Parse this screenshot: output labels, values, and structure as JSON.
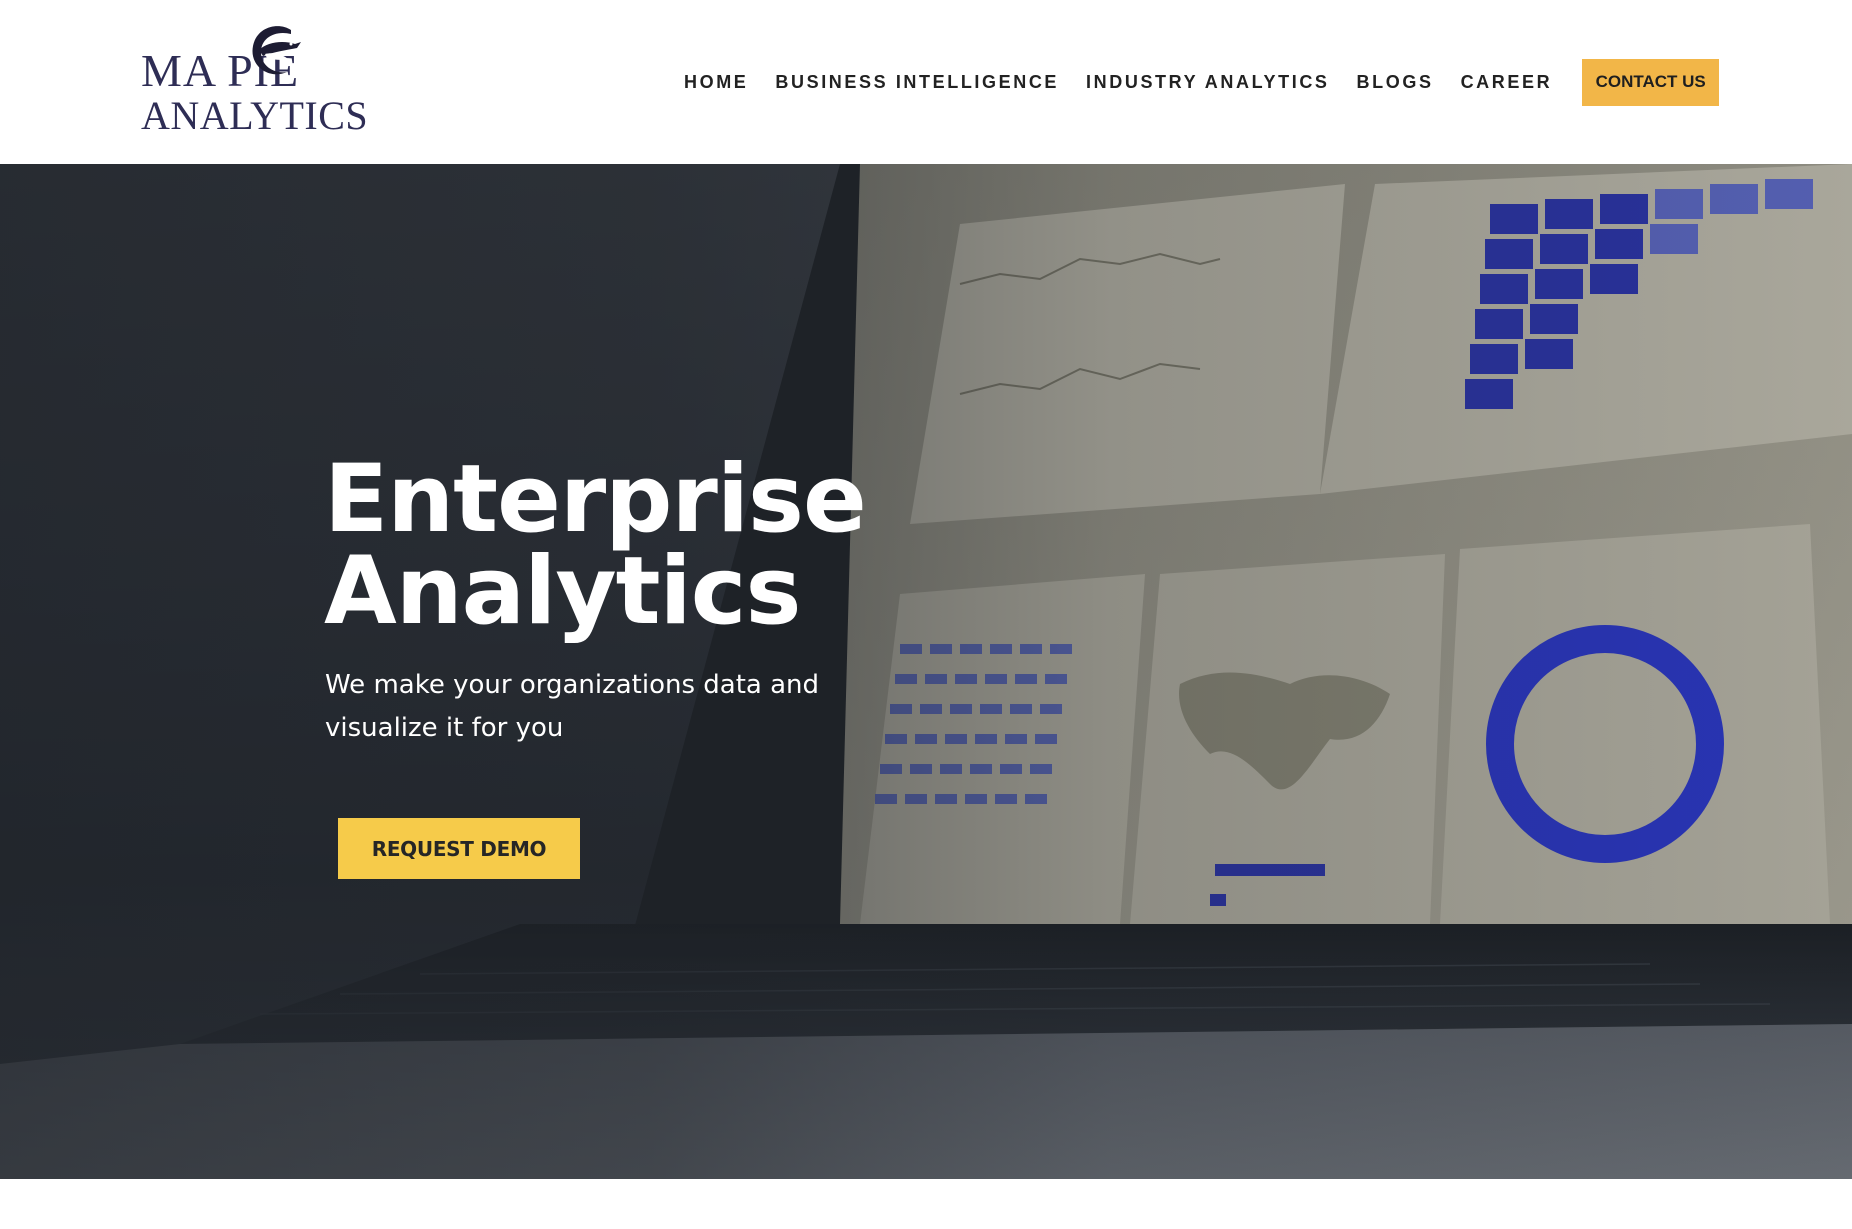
{
  "brand": {
    "logo_line1": "MA  PIE",
    "logo_line2": "ANALYTICS",
    "logo_alt": "Magpie Analytics logo",
    "color": "#2e2d55"
  },
  "nav": {
    "items": [
      {
        "label": "HOME"
      },
      {
        "label": "BUSINESS INTELLIGENCE"
      },
      {
        "label": "INDUSTRY ANALYTICS"
      },
      {
        "label": "BLOGS"
      },
      {
        "label": "CAREER"
      }
    ],
    "contact_label": "CONTACT US",
    "contact_color": "#f2b648"
  },
  "hero": {
    "title_line1": "Enterprise",
    "title_line2": "Analytics",
    "subtitle": "We make your organizations data and visualize it for you",
    "cta_label": "REQUEST DEMO",
    "cta_color": "#f6cb4a",
    "background_image": "laptop-analytics-dashboard"
  }
}
